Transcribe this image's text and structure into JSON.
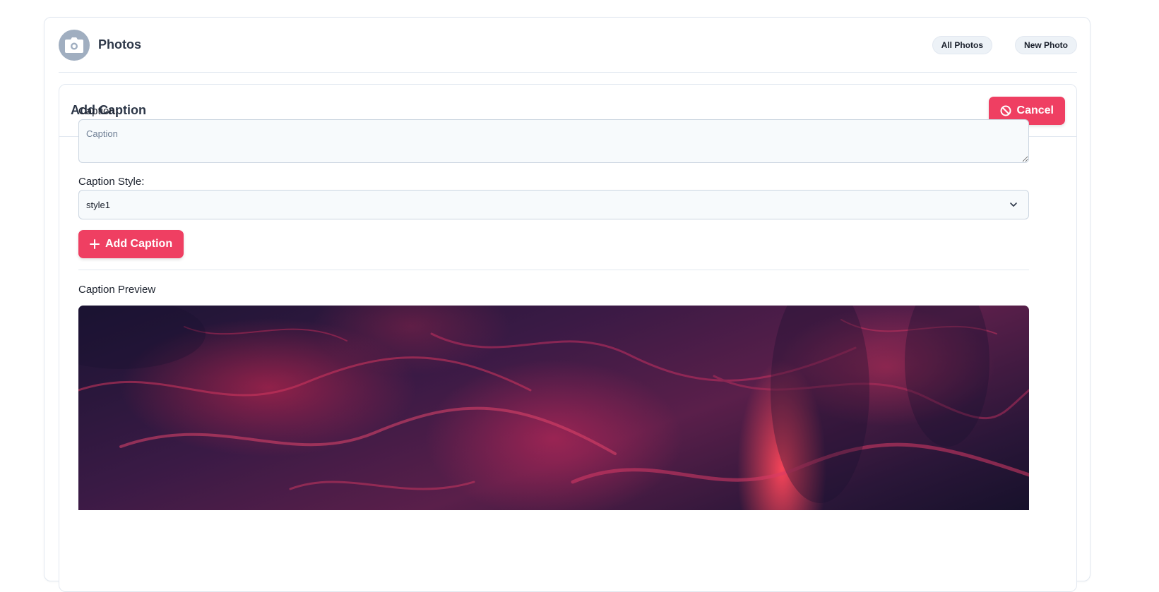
{
  "app": {
    "title": "Photos",
    "logo_icon": "camera-icon"
  },
  "nav": {
    "all_photos": "All Photos",
    "new_photo": "New Photo"
  },
  "panel": {
    "title": "Add Caption",
    "cancel_label": "Cancel",
    "cancel_icon": "ban-icon"
  },
  "form": {
    "caption_label": "Caption:",
    "caption_placeholder": "Caption",
    "caption_value": "",
    "style_label": "Caption Style:",
    "style_value": "style1",
    "submit_label": "Add Caption",
    "submit_icon": "plus-icon"
  },
  "preview": {
    "label": "Caption Preview"
  },
  "colors": {
    "accent": "#ef3f62",
    "border": "#e2e8f0",
    "avatar_bg": "#a0aec0"
  }
}
